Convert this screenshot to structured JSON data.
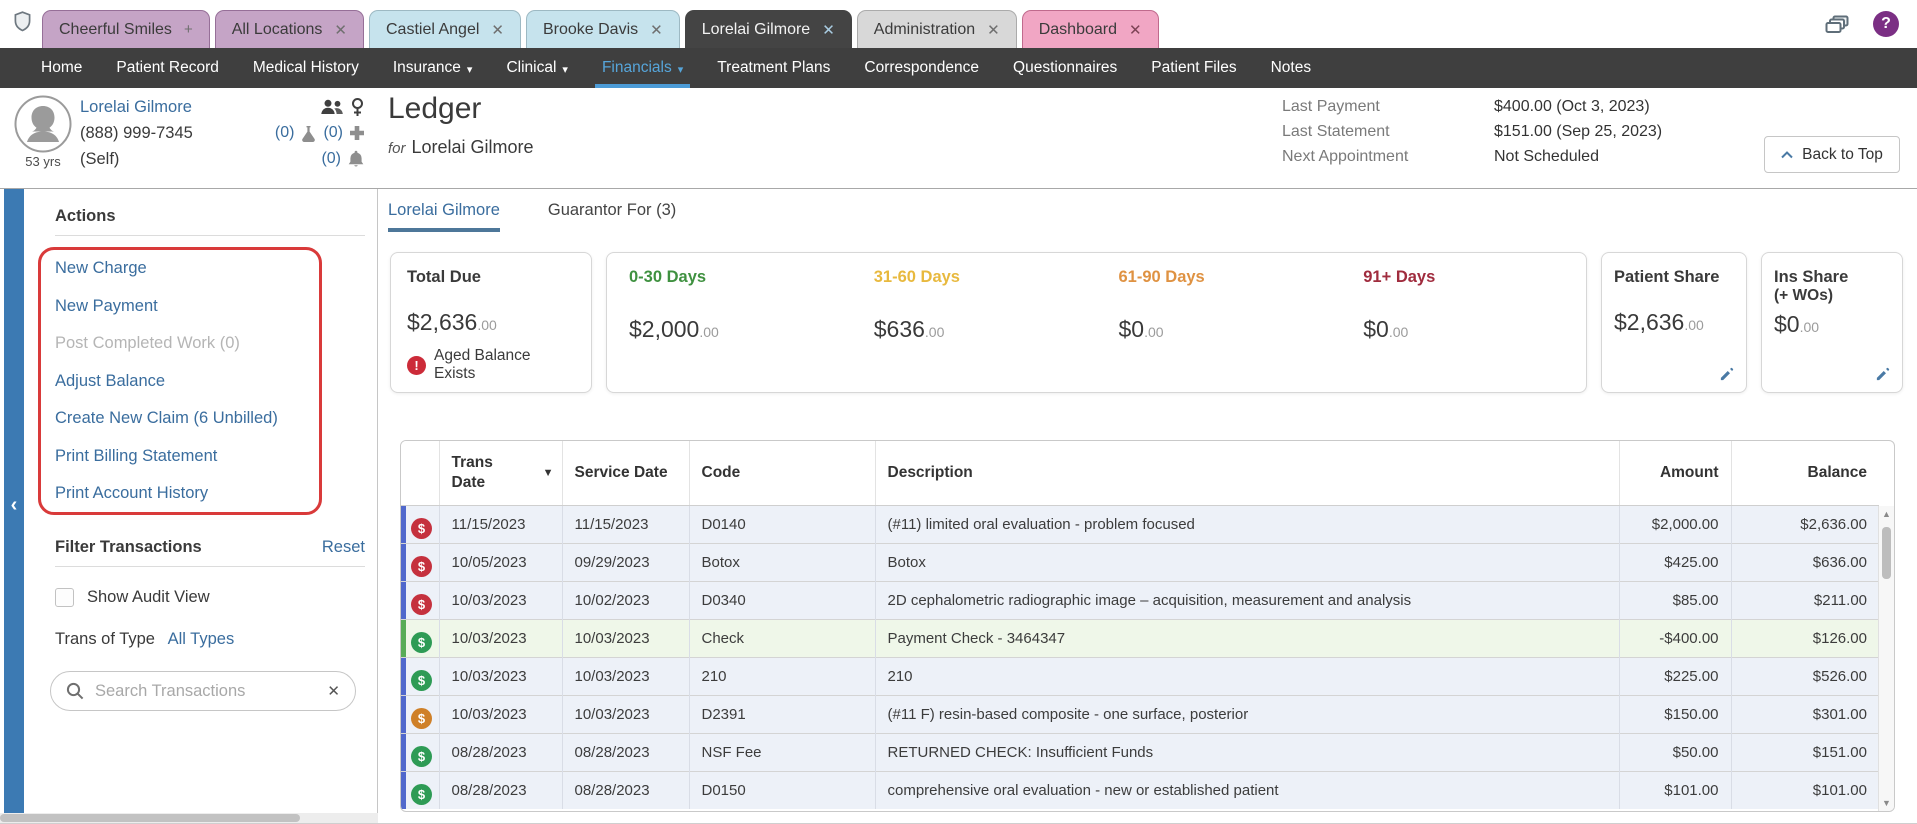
{
  "icons": {
    "close": "✕",
    "add": "+",
    "caret_down": "▾",
    "sort_desc": "▼",
    "collapse_left": "‹",
    "help": "?",
    "warning": "!",
    "dollar": "$"
  },
  "colors": {
    "link_blue": "#3a6d9e",
    "nav_active_blue": "#55a6db",
    "annotation_red": "#d93a3a",
    "collapse_bar_blue": "#3c7ab3",
    "row_bg": "#edf1f8",
    "payment_row_bg": "#eff7e9"
  },
  "window_tabs": {
    "items": [
      {
        "label": "Cheerful Smiles",
        "action": "add"
      },
      {
        "label": "All Locations",
        "action": "close"
      },
      {
        "label": "Castiel Angel",
        "action": "close"
      },
      {
        "label": "Brooke Davis",
        "action": "close"
      },
      {
        "label": "Lorelai Gilmore",
        "action": "close"
      },
      {
        "label": "Administration",
        "action": "close"
      },
      {
        "label": "Dashboard",
        "action": "close"
      }
    ]
  },
  "nav": {
    "items": [
      {
        "label": "Home"
      },
      {
        "label": "Patient Record"
      },
      {
        "label": "Medical History"
      },
      {
        "label": "Insurance"
      },
      {
        "label": "Clinical"
      },
      {
        "label": "Financials"
      },
      {
        "label": "Treatment Plans"
      },
      {
        "label": "Correspondence"
      },
      {
        "label": "Questionnaires"
      },
      {
        "label": "Patient Files"
      },
      {
        "label": "Notes"
      }
    ]
  },
  "patient": {
    "name": "Lorelai Gilmore",
    "phone": "(888) 999-7345",
    "relation": "(Self)",
    "age": "53 yrs",
    "lab_count": "(0)",
    "conditions_count": "(0)",
    "alerts_count": "(0)"
  },
  "header": {
    "title": "Ledger",
    "for_label": "for",
    "for_name": "Lorelai Gilmore",
    "stats": [
      {
        "label": "Last Payment",
        "value": "$400.00 (Oct 3, 2023)"
      },
      {
        "label": "Last Statement",
        "value": "$151.00 (Sep 25, 2023)"
      },
      {
        "label": "Next Appointment",
        "value": "Not Scheduled"
      }
    ],
    "back_to_top": "Back to Top"
  },
  "sidebar": {
    "actions_title": "Actions",
    "actions": [
      {
        "label": "New Charge"
      },
      {
        "label": "New Payment"
      },
      {
        "label": "Post Completed Work (0)",
        "disabled": true
      },
      {
        "label": "Adjust Balance"
      },
      {
        "label": "Create New Claim (6 Unbilled)"
      },
      {
        "label": "Print Billing Statement"
      },
      {
        "label": "Print Account History"
      }
    ],
    "filter": {
      "title": "Filter Transactions",
      "reset": "Reset",
      "audit_label": "Show Audit View",
      "trans_type_label": "Trans of Type",
      "trans_type_value": "All Types",
      "search_placeholder": "Search Transactions"
    }
  },
  "ledger_tabs": [
    {
      "label": "Lorelai Gilmore"
    },
    {
      "label": "Guarantor For (3)"
    }
  ],
  "cards": {
    "total_due": {
      "label": "Total Due",
      "amount": "$2,636",
      "cents": ".00",
      "warning": "Aged Balance Exists"
    },
    "aging": [
      {
        "label": "0-30 Days",
        "color": "#3f9140",
        "amount": "$2,000",
        "cents": ".00"
      },
      {
        "label": "31-60 Days",
        "color": "#e8b93e",
        "amount": "$636",
        "cents": ".00"
      },
      {
        "label": "61-90 Days",
        "color": "#df9242",
        "amount": "$0",
        "cents": ".00"
      },
      {
        "label": "91+ Days",
        "color": "#a02c3e",
        "amount": "$0",
        "cents": ".00"
      }
    ],
    "patient_share": {
      "label": "Patient Share",
      "amount": "$2,636",
      "cents": ".00"
    },
    "ins_share": {
      "label": "Ins Share",
      "label2": "(+ WOs)",
      "amount": "$0",
      "cents": ".00"
    }
  },
  "table": {
    "columns": [
      "",
      "Trans Date",
      "Service Date",
      "Code",
      "Description",
      "Amount",
      "Balance"
    ],
    "rows": [
      {
        "strip": "#5068cc",
        "icon_color": "#c5313e",
        "trans_date": "11/15/2023",
        "service_date": "11/15/2023",
        "code": "D0140",
        "description": "(#11) limited oral evaluation - problem focused",
        "amount": "$2,000.00",
        "balance": "$2,636.00",
        "bg": "#edf1f8"
      },
      {
        "strip": "#5068cc",
        "icon_color": "#c5313e",
        "trans_date": "10/05/2023",
        "service_date": "09/29/2023",
        "code": "Botox",
        "description": "Botox",
        "amount": "$425.00",
        "balance": "$636.00",
        "bg": "#edf1f8"
      },
      {
        "strip": "#5068cc",
        "icon_color": "#c5313e",
        "trans_date": "10/03/2023",
        "service_date": "10/02/2023",
        "code": "D0340",
        "description": "2D cephalometric radiographic image – acquisition, measurement and analysis",
        "amount": "$85.00",
        "balance": "$211.00",
        "bg": "#edf1f8"
      },
      {
        "strip": "#57ac57",
        "icon_color": "#2e9b55",
        "trans_date": "10/03/2023",
        "service_date": "10/03/2023",
        "code": "Check",
        "description": "Payment Check - 3464347",
        "amount": "-$400.00",
        "balance": "$126.00",
        "bg": "#eff7e9"
      },
      {
        "strip": "#5068cc",
        "icon_color": "#2e9b55",
        "trans_date": "10/03/2023",
        "service_date": "10/03/2023",
        "code": "210",
        "description": "210",
        "amount": "$225.00",
        "balance": "$526.00",
        "bg": "#edf1f8"
      },
      {
        "strip": "#5068cc",
        "icon_color": "#cf8028",
        "trans_date": "10/03/2023",
        "service_date": "10/03/2023",
        "code": "D2391",
        "description": "(#11 F) resin-based composite - one surface, posterior",
        "amount": "$150.00",
        "balance": "$301.00",
        "bg": "#edf1f8"
      },
      {
        "strip": "#5068cc",
        "icon_color": "#2e9b55",
        "trans_date": "08/28/2023",
        "service_date": "08/28/2023",
        "code": "NSF Fee",
        "description": "RETURNED CHECK: Insufficient Funds",
        "amount": "$50.00",
        "balance": "$151.00",
        "bg": "#edf1f8"
      },
      {
        "strip": "#5068cc",
        "icon_color": "#2e9b55",
        "trans_date": "08/28/2023",
        "service_date": "08/28/2023",
        "code": "D0150",
        "description": "comprehensive oral evaluation - new or established patient",
        "amount": "$101.00",
        "balance": "$101.00",
        "bg": "#edf1f8"
      }
    ]
  }
}
